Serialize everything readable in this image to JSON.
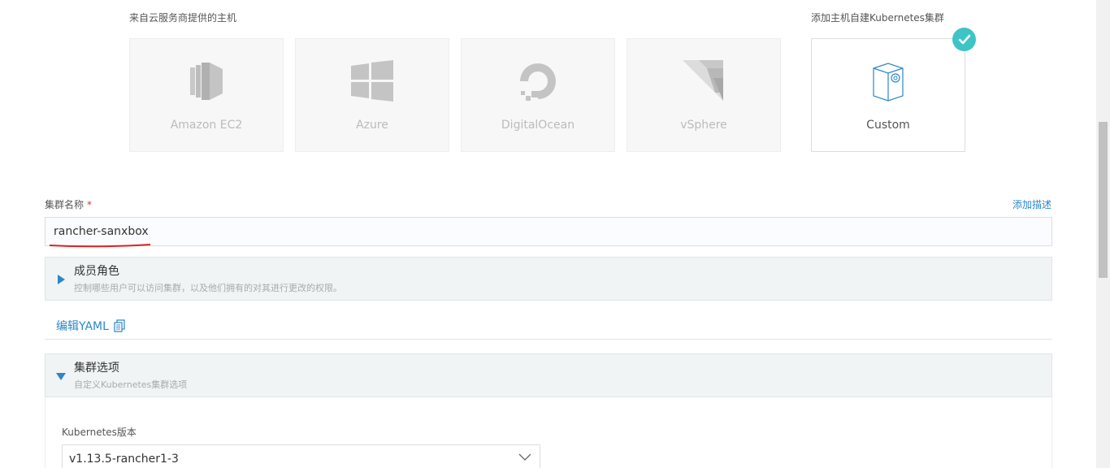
{
  "providers_section": {
    "label": "来自云服务商提供的主机"
  },
  "custom_section": {
    "label": "添加主机自建Kubernetes集群"
  },
  "providers": [
    {
      "name": "Amazon EC2",
      "icon": "amazon-ec2-icon"
    },
    {
      "name": "Azure",
      "icon": "windows-icon"
    },
    {
      "name": "DigitalOcean",
      "icon": "digitalocean-icon"
    },
    {
      "name": "vSphere",
      "icon": "vsphere-icon"
    }
  ],
  "custom": {
    "name": "Custom",
    "icon": "custom-box-icon",
    "selected": true
  },
  "cluster_name": {
    "label": "集群名称",
    "required_mark": "*",
    "value": "rancher-sanxbox",
    "add_description": "添加描述"
  },
  "member_roles": {
    "title": "成员角色",
    "description": "控制哪些用户可以访问集群，以及他们拥有的对其进行更改的权限。"
  },
  "edit_yaml": {
    "label": "编辑YAML"
  },
  "cluster_options": {
    "title": "集群选项",
    "description": "自定义Kubernetes集群选项"
  },
  "kubernetes_version": {
    "label": "Kubernetes版本",
    "value": "v1.13.5-rancher1-3"
  },
  "colors": {
    "accent": "#2b87c8",
    "check": "#3ec4c7",
    "annotation": "#e02020"
  }
}
